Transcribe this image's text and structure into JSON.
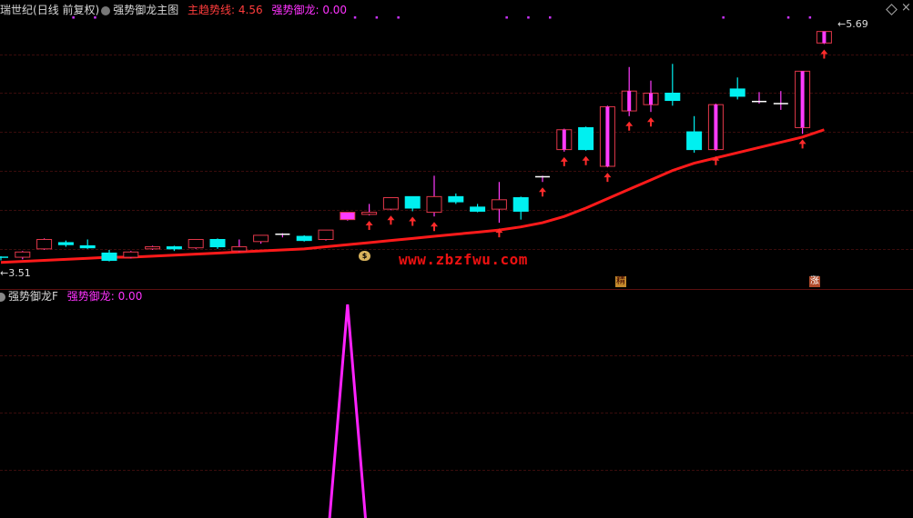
{
  "header": {
    "stock_name_fragment": "瑞世纪",
    "period_label": "(日线 前复权)",
    "indicator_name": "强势御龙主图",
    "line1_label": "主趋势线:",
    "line1_value": "4.56",
    "line2_label": "强势御龙:",
    "line2_value": "0.00"
  },
  "lower_header": {
    "indicator_name": "强势御龙F",
    "line_label": "强势御龙:",
    "line_value": "0.00"
  },
  "annotations": {
    "high_price": "5.69",
    "low_price": "3.51",
    "watermark": "www.zbzfwu.com",
    "tag1": "精",
    "tag2": "涨",
    "money_bag": "$"
  },
  "colors": {
    "up": "#ff3bff",
    "down": "#00f0f0",
    "up_border": "#e2374a",
    "trend": "#ff1a1a",
    "signal": "#ff2b2b",
    "oscillator": "#ff22ff",
    "header_red": "#ff3c3c",
    "header_magenta": "#ff33ff"
  },
  "chart_data": {
    "type": "candlestick",
    "candles": [
      {
        "o": 3.53,
        "c": 3.52,
        "h": 3.54,
        "l": 3.5
      },
      {
        "o": 3.53,
        "c": 3.58,
        "h": 3.59,
        "l": 3.51
      },
      {
        "o": 3.61,
        "c": 3.7,
        "h": 3.71,
        "l": 3.6
      },
      {
        "o": 3.67,
        "c": 3.65,
        "h": 3.69,
        "l": 3.63
      },
      {
        "o": 3.64,
        "c": 3.62,
        "h": 3.7,
        "l": 3.61
      },
      {
        "o": 3.57,
        "c": 3.5,
        "h": 3.6,
        "l": 3.49
      },
      {
        "o": 3.53,
        "c": 3.58,
        "h": 3.59,
        "l": 3.52
      },
      {
        "o": 3.61,
        "c": 3.63,
        "h": 3.64,
        "l": 3.6
      },
      {
        "o": 3.63,
        "c": 3.61,
        "h": 3.64,
        "l": 3.59
      },
      {
        "o": 3.62,
        "c": 3.7,
        "h": 3.7,
        "l": 3.61
      },
      {
        "o": 3.7,
        "c": 3.63,
        "h": 3.71,
        "l": 3.61
      },
      {
        "o": 3.59,
        "c": 3.63,
        "h": 3.7,
        "l": 3.58
      },
      {
        "o": 3.68,
        "c": 3.74,
        "h": 3.74,
        "l": 3.66
      },
      {
        "o": 3.74,
        "c": 3.75,
        "h": 3.76,
        "l": 3.72
      },
      {
        "o": 3.73,
        "c": 3.69,
        "h": 3.74,
        "l": 3.68
      },
      {
        "o": 3.7,
        "c": 3.79,
        "h": 3.79,
        "l": 3.69
      },
      {
        "o": 3.89,
        "c": 3.96,
        "h": 3.96,
        "l": 3.88
      },
      {
        "o": 3.94,
        "c": 3.96,
        "h": 4.04,
        "l": 3.93
      },
      {
        "o": 3.99,
        "c": 4.1,
        "h": 4.1,
        "l": 3.98
      },
      {
        "o": 4.11,
        "c": 4.0,
        "h": 4.11,
        "l": 3.97
      },
      {
        "o": 3.96,
        "c": 4.11,
        "h": 4.31,
        "l": 3.92
      },
      {
        "o": 4.11,
        "c": 4.06,
        "h": 4.14,
        "l": 4.04
      },
      {
        "o": 4.01,
        "c": 3.97,
        "h": 4.04,
        "l": 3.96
      },
      {
        "o": 3.99,
        "c": 4.08,
        "h": 4.25,
        "l": 3.86
      },
      {
        "o": 4.1,
        "c": 3.97,
        "h": 4.11,
        "l": 3.89
      },
      {
        "o": 4.3,
        "c": 4.3,
        "h": 4.31,
        "l": 4.25
      },
      {
        "o": 4.56,
        "c": 4.75,
        "h": 4.76,
        "l": 4.54
      },
      {
        "o": 4.77,
        "c": 4.56,
        "h": 4.78,
        "l": 4.55
      },
      {
        "o": 4.4,
        "c": 4.97,
        "h": 4.98,
        "l": 4.39
      },
      {
        "o": 4.93,
        "c": 5.12,
        "h": 5.35,
        "l": 4.88
      },
      {
        "o": 4.99,
        "c": 5.1,
        "h": 5.22,
        "l": 4.92
      },
      {
        "o": 5.1,
        "c": 5.03,
        "h": 5.38,
        "l": 4.98
      },
      {
        "o": 4.73,
        "c": 4.56,
        "h": 4.88,
        "l": 4.53
      },
      {
        "o": 4.56,
        "c": 4.99,
        "h": 5.0,
        "l": 4.55
      },
      {
        "o": 5.14,
        "c": 5.07,
        "h": 5.25,
        "l": 5.04
      },
      {
        "o": 5.02,
        "c": 5.02,
        "h": 5.11,
        "l": 5.0
      },
      {
        "o": 5.0,
        "c": 5.0,
        "h": 5.12,
        "l": 4.94
      },
      {
        "o": 4.77,
        "c": 5.31,
        "h": 5.31,
        "l": 4.71
      },
      {
        "o": 5.58,
        "c": 5.69,
        "h": 5.69,
        "l": 5.57
      }
    ],
    "trend_line": [
      3.48,
      3.49,
      3.5,
      3.51,
      3.52,
      3.53,
      3.53,
      3.54,
      3.55,
      3.56,
      3.57,
      3.58,
      3.59,
      3.6,
      3.61,
      3.63,
      3.65,
      3.67,
      3.69,
      3.71,
      3.73,
      3.75,
      3.77,
      3.79,
      3.82,
      3.86,
      3.92,
      4.0,
      4.09,
      4.18,
      4.27,
      4.36,
      4.43,
      4.48,
      4.53,
      4.58,
      4.63,
      4.68,
      4.75
    ],
    "signal_candles": [
      17,
      18,
      19,
      20,
      23,
      25,
      26,
      27,
      28,
      29,
      30,
      33,
      37,
      38
    ],
    "marker_dots": [
      3,
      4,
      16,
      17,
      18,
      23,
      24,
      25,
      33,
      36,
      37
    ],
    "oscillator_peak_index": 16,
    "price_axis": {
      "min": 3.4,
      "max": 5.8
    }
  }
}
